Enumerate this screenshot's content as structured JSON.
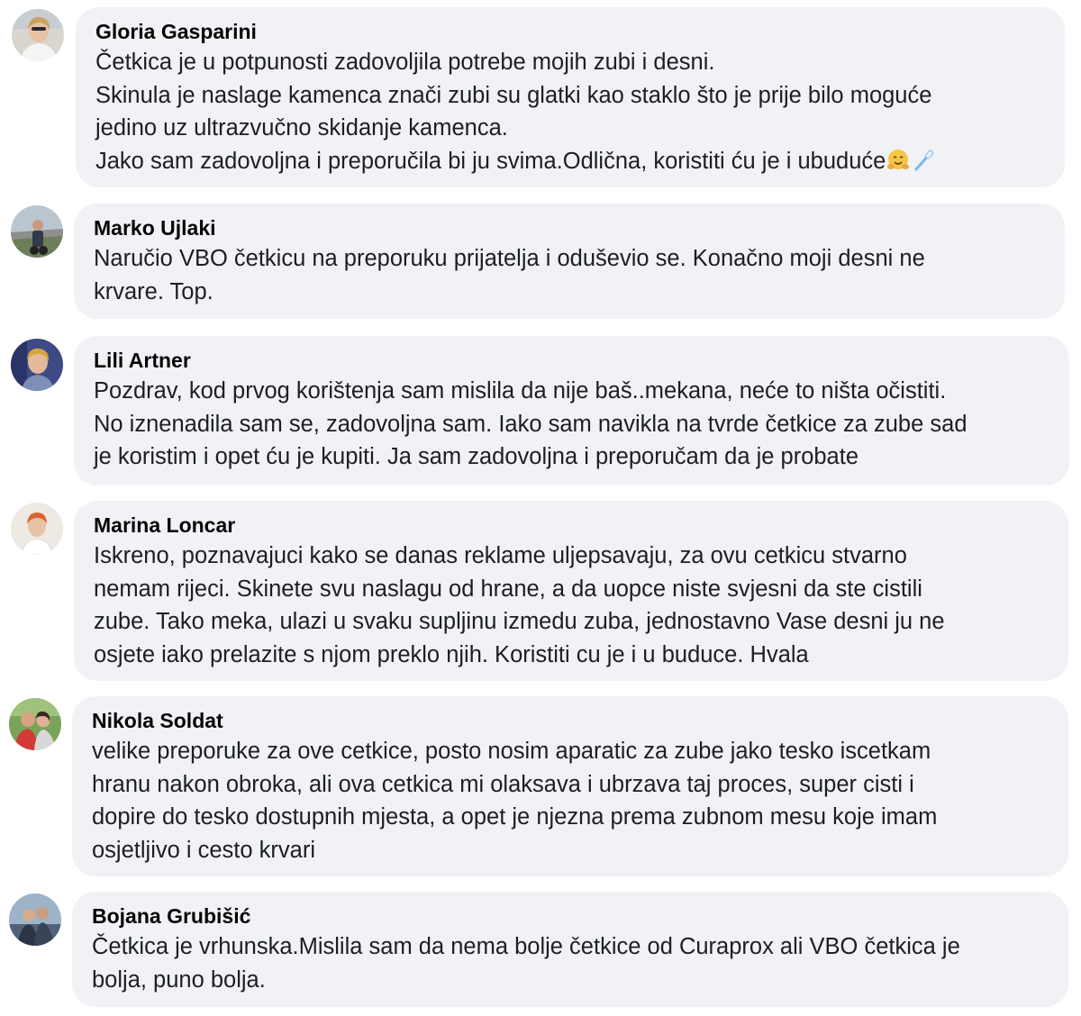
{
  "comments": [
    {
      "author": "Gloria Gasparini",
      "lines": [
        "Četkica je u potpunosti zadovoljila potrebe mojih zubi i desni.",
        "Skinula je naslage kamenca znači zubi su glatki kao staklo što je prije bilo moguće",
        "jedino uz ultrazvučno skidanje kamenca.",
        "Jako sam zadovoljna i preporučila bi ju svima.Odlična, koristiti ću je i ubuduće"
      ],
      "emojis": [
        "hugging-face-icon",
        "toothbrush-icon"
      ]
    },
    {
      "author": "Marko Ujlaki",
      "lines": [
        "Naručio VBO četkicu na preporuku prijatelja i oduševio se. Konačno moji desni ne",
        "krvare. Top."
      ]
    },
    {
      "author": "Lili Artner",
      "lines": [
        "Pozdrav, kod prvog korištenja sam mislila da nije baš..mekana, neće to ništa očistiti.",
        "No iznenadila sam se, zadovoljna sam. Iako sam navikla na tvrde četkice za zube sad",
        "je koristim i opet ću je kupiti. Ja sam zadovoljna i preporučam da je probate"
      ]
    },
    {
      "author": "Marina Loncar",
      "lines": [
        "Iskreno, poznavajuci kako se danas reklame uljepsavaju, za ovu cetkicu stvarno",
        "nemam rijeci. Skinete svu naslagu od hrane, a da uopce niste svjesni da ste cistili",
        "zube. Tako meka, ulazi u svaku supljinu izmedu zuba, jednostavno Vase desni ju ne",
        "osjete iako prelazite s njom preklo njih. Koristiti cu je i u buduce. Hvala"
      ]
    },
    {
      "author": "Nikola Soldat",
      "lines": [
        "velike preporuke za ove cetkice, posto nosim aparatic za zube jako tesko iscetkam",
        "hranu nakon obroka, ali ova cetkica mi olaksava i ubrzava taj proces, super cisti i",
        "dopire do tesko dostupnih mjesta, a opet je njezna prema zubnom mesu koje imam",
        "osjetljivo i cesto krvari"
      ]
    },
    {
      "author": "Bojana Grubišić",
      "lines": [
        "Četkica je vrhunska.Mislila sam da nema bolje četkice od Curaprox ali VBO četkica je",
        "bolja, puno bolja."
      ]
    }
  ],
  "colors": {
    "bubble": "#f0f2f5",
    "name": "#050505",
    "text": "#1c1e21"
  }
}
